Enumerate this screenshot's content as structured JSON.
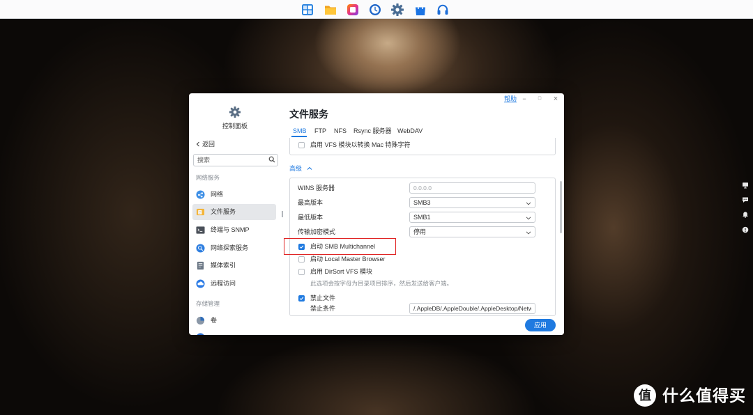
{
  "theme": {
    "accent": "#1f7ae0",
    "highlight": "#e02424"
  },
  "dock": {
    "items": [
      {
        "icon": "app-center-icon"
      },
      {
        "icon": "file-station-icon"
      },
      {
        "icon": "photos-icon"
      },
      {
        "icon": "clock-icon"
      },
      {
        "icon": "control-panel-gear-icon"
      },
      {
        "icon": "shop-bag-icon"
      },
      {
        "icon": "support-headset-icon"
      }
    ]
  },
  "window": {
    "help_label": "帮助",
    "controls": {
      "minimize": "−",
      "maximize": "□",
      "close": "×"
    },
    "sidebar": {
      "app_icon": "gear-icon",
      "app_name": "控制面板",
      "back_label": "返回",
      "search_placeholder": "搜索",
      "sections": [
        {
          "title": "网络服务",
          "items": [
            {
              "label": "网络",
              "icon": "network-icon"
            },
            {
              "label": "文件服务",
              "icon": "file-service-icon",
              "selected": true
            },
            {
              "label": "终端与 SNMP",
              "icon": "terminal-icon"
            },
            {
              "label": "网络探索服务",
              "icon": "network-discovery-icon"
            },
            {
              "label": "媒体索引",
              "icon": "media-index-icon"
            },
            {
              "label": "远程访问",
              "icon": "remote-access-icon"
            }
          ]
        },
        {
          "title": "存储管理",
          "items": [
            {
              "label": "卷",
              "icon": "volume-icon"
            },
            {
              "icon": "storage-icon"
            }
          ]
        }
      ]
    },
    "main": {
      "title": "文件服务",
      "tabs": [
        {
          "label": "SMB",
          "active": true
        },
        {
          "label": "FTP"
        },
        {
          "label": "NFS"
        },
        {
          "label": "Rsync 服务器"
        },
        {
          "label": "WebDAV"
        }
      ],
      "vfs_option": {
        "label": "启用 VFS 模块以转换 Mac 特殊字符",
        "checked": false
      },
      "advanced": {
        "label": "高级",
        "expanded": true,
        "wins": {
          "label": "WINS 服务器",
          "placeholder": "0.0.0.0"
        },
        "max_version": {
          "label": "最高版本",
          "value": "SMB3"
        },
        "min_version": {
          "label": "最低版本",
          "value": "SMB1"
        },
        "encryption": {
          "label": "传输加密模式",
          "value": "停用"
        },
        "multichannel": {
          "label": "启动 SMB Multichannel",
          "checked": true
        },
        "local_master": {
          "label": "启动 Local Master Browser",
          "checked": false
        },
        "dirsort": {
          "label": "启用 DirSort VFS 模块",
          "checked": false,
          "hint": "此选项会按字母为目录项目排序，然后发送给客户端。"
        },
        "veto_files": {
          "label": "禁止文件",
          "checked": true,
          "condition_label": "禁止条件",
          "condition_value": "/.AppleDB/.AppleDouble/.AppleDesktop/Networ"
        }
      },
      "apply_label": "应用"
    }
  },
  "side_tray": {
    "items": [
      {
        "icon": "monitor-icon"
      },
      {
        "icon": "chat-icon"
      },
      {
        "icon": "bell-icon"
      },
      {
        "icon": "info-icon"
      }
    ]
  },
  "watermark": {
    "glyph": "值",
    "text": "什么值得买"
  }
}
